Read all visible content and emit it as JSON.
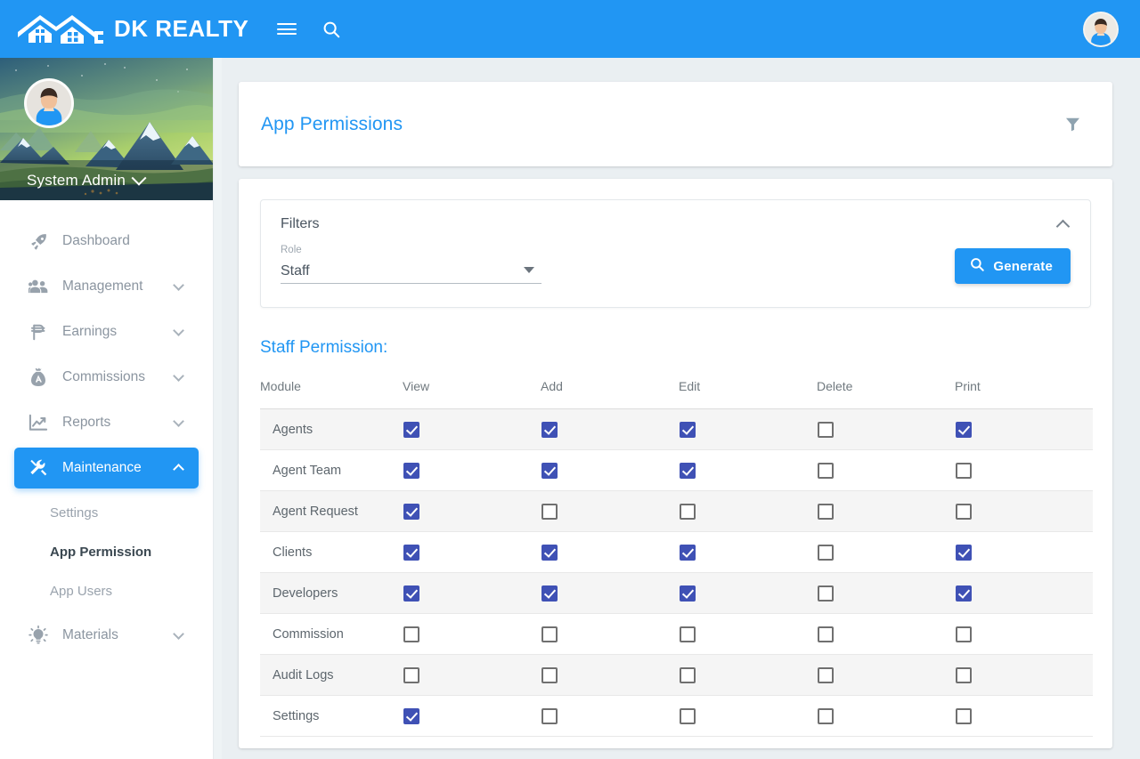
{
  "topbar": {
    "brand_name": "DK REALTY",
    "logo_icon": "house-roofs-logo",
    "menu_icon": "hamburger-menu-icon",
    "search_icon": "search-icon",
    "avatar_icon": "user-avatar"
  },
  "sidebar": {
    "profile": {
      "name": "System Admin",
      "caret_icon": "chevron-down-icon",
      "avatar_icon": "user-avatar"
    },
    "items": [
      {
        "label": "Dashboard",
        "icon": "rocket-icon",
        "has_chevron": false,
        "active": false
      },
      {
        "label": "Management",
        "icon": "people-icon",
        "has_chevron": true,
        "active": false
      },
      {
        "label": "Earnings",
        "icon": "peso-icon",
        "has_chevron": true,
        "active": false
      },
      {
        "label": "Commissions",
        "icon": "money-bag-icon",
        "has_chevron": true,
        "active": false
      },
      {
        "label": "Reports",
        "icon": "chart-line-icon",
        "has_chevron": true,
        "active": false
      },
      {
        "label": "Maintenance",
        "icon": "tools-icon",
        "has_chevron": true,
        "active": true
      }
    ],
    "sub_items": [
      {
        "label": "Settings",
        "current": false
      },
      {
        "label": "App Permission",
        "current": true
      },
      {
        "label": "App Users",
        "current": false
      }
    ],
    "items_after": [
      {
        "label": "Materials",
        "icon": "lightbulb-icon",
        "has_chevron": true,
        "active": false
      }
    ]
  },
  "header_card": {
    "title": "App Permissions",
    "filter_icon": "funnel-filter-icon"
  },
  "filters": {
    "title": "Filters",
    "collapse_icon": "chevron-up-icon",
    "role_field": {
      "label": "Role",
      "value": "Staff",
      "dropdown_icon": "triangle-down-icon"
    },
    "generate_button": {
      "label": "Generate",
      "icon": "search-icon"
    }
  },
  "permissions": {
    "section_title": "Staff Permission:",
    "columns": [
      "Module",
      "View",
      "Add",
      "Edit",
      "Delete",
      "Print"
    ],
    "rows": [
      {
        "module": "Agents",
        "view": true,
        "add": true,
        "edit": true,
        "delete": false,
        "print": true
      },
      {
        "module": "Agent Team",
        "view": true,
        "add": true,
        "edit": true,
        "delete": false,
        "print": false
      },
      {
        "module": "Agent Request",
        "view": true,
        "add": false,
        "edit": false,
        "delete": false,
        "print": false
      },
      {
        "module": "Clients",
        "view": true,
        "add": true,
        "edit": true,
        "delete": false,
        "print": true
      },
      {
        "module": "Developers",
        "view": true,
        "add": true,
        "edit": true,
        "delete": false,
        "print": true
      },
      {
        "module": "Commission",
        "view": false,
        "add": false,
        "edit": false,
        "delete": false,
        "print": false
      },
      {
        "module": "Audit Logs",
        "view": false,
        "add": false,
        "edit": false,
        "delete": false,
        "print": false
      },
      {
        "module": "Settings",
        "view": true,
        "add": false,
        "edit": false,
        "delete": false,
        "print": false
      }
    ]
  },
  "colors": {
    "brand_blue": "#2196f3",
    "checkbox_blue": "#3f51b5",
    "page_bg": "#eaeff2",
    "link_blue": "#2196f3"
  }
}
